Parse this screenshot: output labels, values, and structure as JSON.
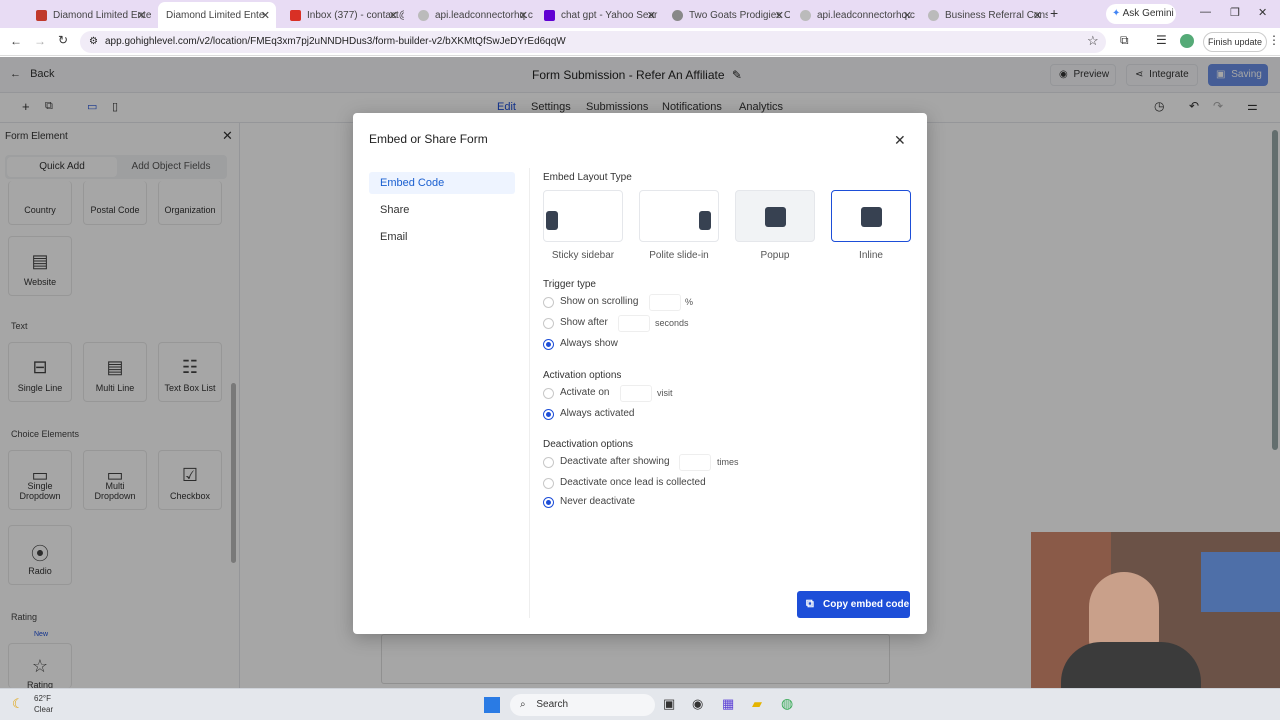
{
  "browser": {
    "tabs": [
      {
        "title": "Diamond Limited Ente",
        "color": "#c0392b"
      },
      {
        "title": "Diamond Limited Ente",
        "color": "#c0392b",
        "active": true
      },
      {
        "title": "Inbox (377) - contact@",
        "color": "#d93025"
      },
      {
        "title": "api.leadconnectorhq.c",
        "color": "#666666"
      },
      {
        "title": "chat gpt - Yahoo Sear",
        "color": "#6001d2"
      },
      {
        "title": "Two Goats Prodigies O",
        "color": "#555555"
      },
      {
        "title": "api.leadconnectorhq.c",
        "color": "#666666"
      },
      {
        "title": "Business Referral Cons",
        "color": "#666666"
      }
    ],
    "ask_gemini": "Ask Gemini",
    "url": "app.gohighlevel.com/v2/location/FMEq3xm7pj2uNNDHDus3/form-builder-v2/bXKMtQfSwJeDYrEd6qqW",
    "finish_update": "Finish update"
  },
  "app": {
    "back_label": "Back",
    "form_title": "Form Submission - Refer An Affiliate",
    "preview_label": "Preview",
    "integrate_label": "Integrate",
    "saving_label": "Saving",
    "tabs": [
      "Edit",
      "Settings",
      "Submissions",
      "Notifications",
      "Analytics"
    ]
  },
  "left_panel": {
    "title": "Form Element",
    "tabs": [
      "Quick Add",
      "Add Object Fields"
    ],
    "row1": [
      "Country",
      "Postal Code",
      "Organization"
    ],
    "website": "Website",
    "text_section": "Text",
    "text_items": [
      "Single Line",
      "Multi Line",
      "Text Box List"
    ],
    "choice_section": "Choice Elements",
    "choice_items": [
      "Single Dropdown",
      "Multi Dropdown",
      "Checkbox"
    ],
    "radio": "Radio",
    "rating_section": "Rating",
    "new_badge": "New",
    "rating_item": "Rating"
  },
  "modal": {
    "title": "Embed or Share Form",
    "menu": [
      "Embed Code",
      "Share",
      "Email"
    ],
    "layout_title": "Embed Layout Type",
    "layouts": [
      "Sticky sidebar",
      "Polite slide-in",
      "Popup",
      "Inline"
    ],
    "trigger_title": "Trigger type",
    "trigger_options": [
      "Show on scrolling",
      "Show after",
      "Always show"
    ],
    "trigger_units": [
      "%",
      "seconds"
    ],
    "activation_title": "Activation options",
    "activation_options": [
      "Activate on",
      "Always activated"
    ],
    "activation_unit": "visit",
    "deactivation_title": "Deactivation options",
    "deactivation_options": [
      "Deactivate after showing",
      "Deactivate once lead is collected",
      "Never deactivate"
    ],
    "deactivation_unit": "times",
    "copy_button": "Copy embed code"
  },
  "taskbar": {
    "weather_temp": "62°F",
    "weather_desc": "Clear",
    "search": "Search"
  },
  "colors": {
    "accent": "#1d4ed8",
    "tabbar": "#e8dcf4"
  }
}
